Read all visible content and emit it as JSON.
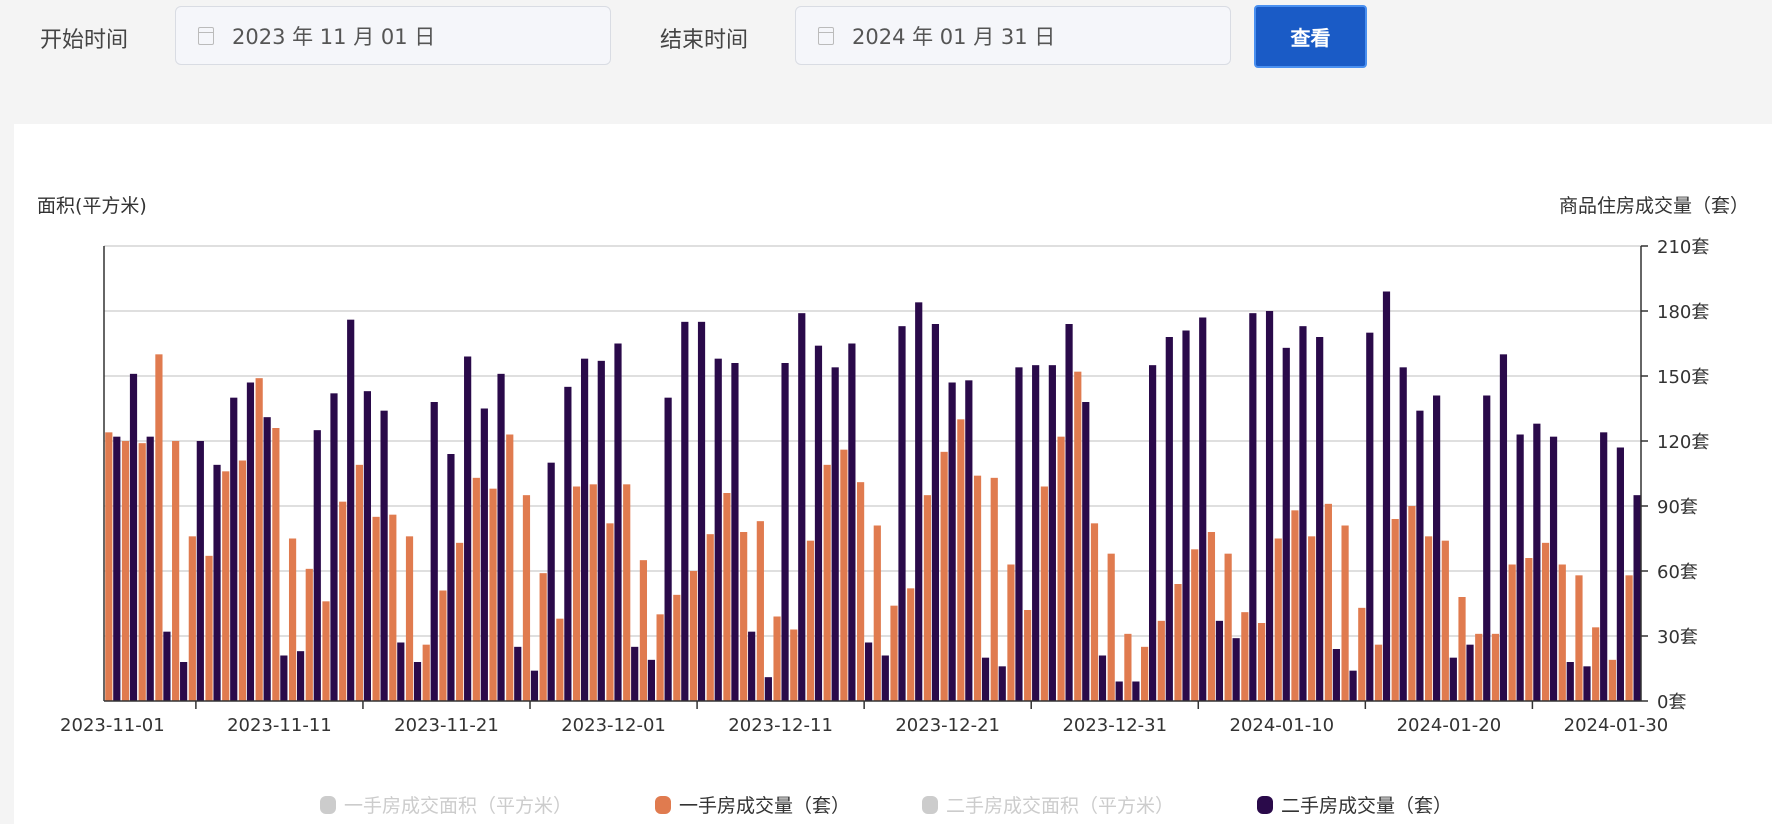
{
  "filters": {
    "start_label": "开始时间",
    "start_value": "2023 年 11 月 01 日",
    "end_label": "结束时间",
    "end_value": "2024 年 01 月 31 日",
    "view_button": "查看"
  },
  "colors": {
    "new": "#e07b4f",
    "second": "#2a0a4a",
    "disabled": "#cccccc",
    "grid": "#cccccc"
  },
  "chart_data": {
    "type": "bar",
    "left_axis_title": "面积(平方米)",
    "right_axis_title": "商品住房成交量（套）",
    "ylim": [
      0,
      210
    ],
    "y_ticks": [
      0,
      30,
      60,
      90,
      120,
      150,
      180,
      210
    ],
    "y_tick_suffix": "套",
    "y_tick_labels": [
      "0套",
      "30套",
      "60套",
      "90套",
      "120套",
      "150套",
      "180套",
      "210套"
    ],
    "x_start": "2023-11-01",
    "x_tick_labels": [
      "2023-11-01",
      "2023-11-11",
      "2023-11-21",
      "2023-12-01",
      "2023-12-11",
      "2023-12-21",
      "2023-12-31",
      "2024-01-10",
      "2024-01-20",
      "2024-01-30"
    ],
    "grid": true,
    "legend_position": "bottom",
    "legend": [
      {
        "name": "一手房成交面积（平方米）",
        "enabled": false
      },
      {
        "name": "一手房成交量（套）",
        "enabled": true
      },
      {
        "name": "二手房成交面积（平方米）",
        "enabled": false
      },
      {
        "name": "二手房成交量（套）",
        "enabled": true
      }
    ],
    "series": [
      {
        "name": "一手房成交量（套）",
        "values": [
          124,
          120,
          119,
          160,
          120,
          76,
          67,
          106,
          111,
          149,
          126,
          75,
          61,
          46,
          92,
          109,
          85,
          86,
          76,
          26,
          51,
          73,
          103,
          98,
          123,
          95,
          59,
          38,
          99,
          100,
          82,
          100,
          65,
          40,
          49,
          60,
          77,
          96,
          78,
          83,
          39,
          33,
          74,
          109,
          116,
          101,
          81,
          44,
          52,
          95,
          115,
          130,
          104,
          103,
          63,
          42,
          99,
          122,
          152,
          82,
          68,
          31,
          25,
          37,
          54,
          70,
          78,
          68,
          41,
          36,
          75,
          88,
          76,
          91,
          81,
          43,
          26,
          84,
          90,
          76,
          74,
          48,
          31,
          31,
          63,
          66,
          73,
          63,
          58,
          34,
          19,
          58
        ]
      },
      {
        "name": "二手房成交量（套）",
        "values": [
          122,
          151,
          122,
          32,
          18,
          120,
          109,
          140,
          147,
          131,
          21,
          23,
          125,
          142,
          176,
          143,
          134,
          27,
          18,
          138,
          114,
          159,
          135,
          151,
          25,
          14,
          110,
          145,
          158,
          157,
          165,
          25,
          19,
          140,
          175,
          175,
          158,
          156,
          32,
          11,
          156,
          179,
          164,
          154,
          165,
          27,
          21,
          173,
          184,
          174,
          147,
          148,
          20,
          16,
          154,
          155,
          155,
          174,
          138,
          21,
          9,
          9,
          155,
          168,
          171,
          177,
          37,
          29,
          179,
          180,
          163,
          173,
          168,
          24,
          14,
          170,
          189,
          154,
          134,
          141,
          20,
          26,
          141,
          160,
          123,
          128,
          122,
          18,
          16,
          124,
          117,
          95
        ]
      }
    ]
  }
}
